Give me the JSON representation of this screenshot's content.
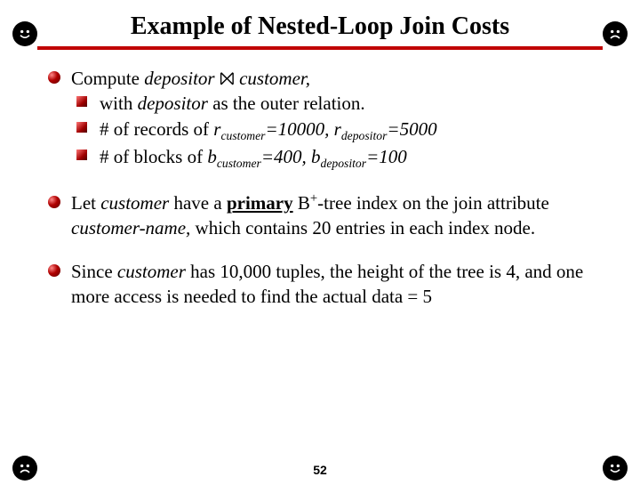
{
  "title": "Example of Nested-Loop Join Costs",
  "page_number": "52",
  "bullets": {
    "b1": {
      "compute_prefix": "Compute ",
      "depositor": "depositor",
      "join_symbol": " ⨝ ",
      "customer": "customer,",
      "sub1_prefix": "with ",
      "sub1_depositor": "depositor",
      "sub1_suffix": " as the outer relation.",
      "sub2_prefix": "# of records of ",
      "sub2_r": "r",
      "sub2_cust": "customer",
      "sub2_eq1": "=10000, ",
      "sub2_r2": "r",
      "sub2_dep": "depositor",
      "sub2_eq2": "=5000",
      "sub3_prefix": "# of blocks of  ",
      "sub3_b": "b",
      "sub3_cust": "customer",
      "sub3_eq1": "=400, ",
      "sub3_b2": "b",
      "sub3_dep": "depositor",
      "sub3_eq2": "=100"
    },
    "b2": {
      "p1": "Let ",
      "p2": "customer",
      "p3": " have a ",
      "p4": "primary",
      "p5": " B",
      "p6": "+",
      "p7": "-tree index on the join attribute ",
      "p8": "customer-name,",
      "p9": " which contains 20 entries in each index node."
    },
    "b3": {
      "p1": "Since ",
      "p2": "customer",
      "p3": " has 10,000 tuples, the height of the tree is 4, and one more access is needed to find the actual data = 5"
    }
  },
  "icons": {
    "smile": "smile-icon",
    "sad": "sad-icon"
  }
}
